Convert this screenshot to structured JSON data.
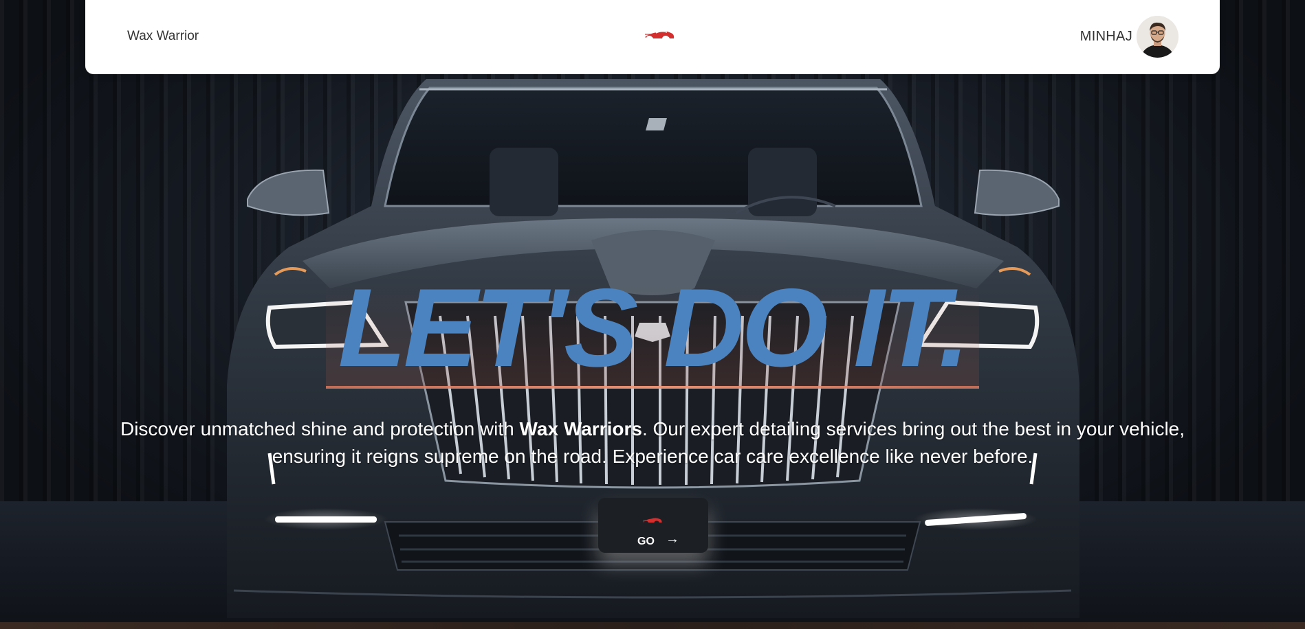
{
  "navbar": {
    "brand_name": "Wax Warrior",
    "logo_icon": "sports-car-logo-icon",
    "user_name": "MINHAJ",
    "avatar_icon": "user-avatar"
  },
  "hero": {
    "headline": "LET'S DO IT.",
    "tagline_part1": "Discover unmatched shine and protection with ",
    "tagline_brand": "Wax Warriors",
    "tagline_part2": ". Our expert detailing services bring out the best in your vehicle, ensuring it reigns supreme on the road. Experience car care excellence like never before.",
    "go_button": {
      "label": "GO",
      "arrow": "→",
      "icon": "sports-car-logo-icon"
    }
  },
  "colors": {
    "headline": "#4a83bf",
    "logo_red": "#d32f2f",
    "navbar_bg": "#ffffff",
    "button_bg": "#1c1f24"
  }
}
